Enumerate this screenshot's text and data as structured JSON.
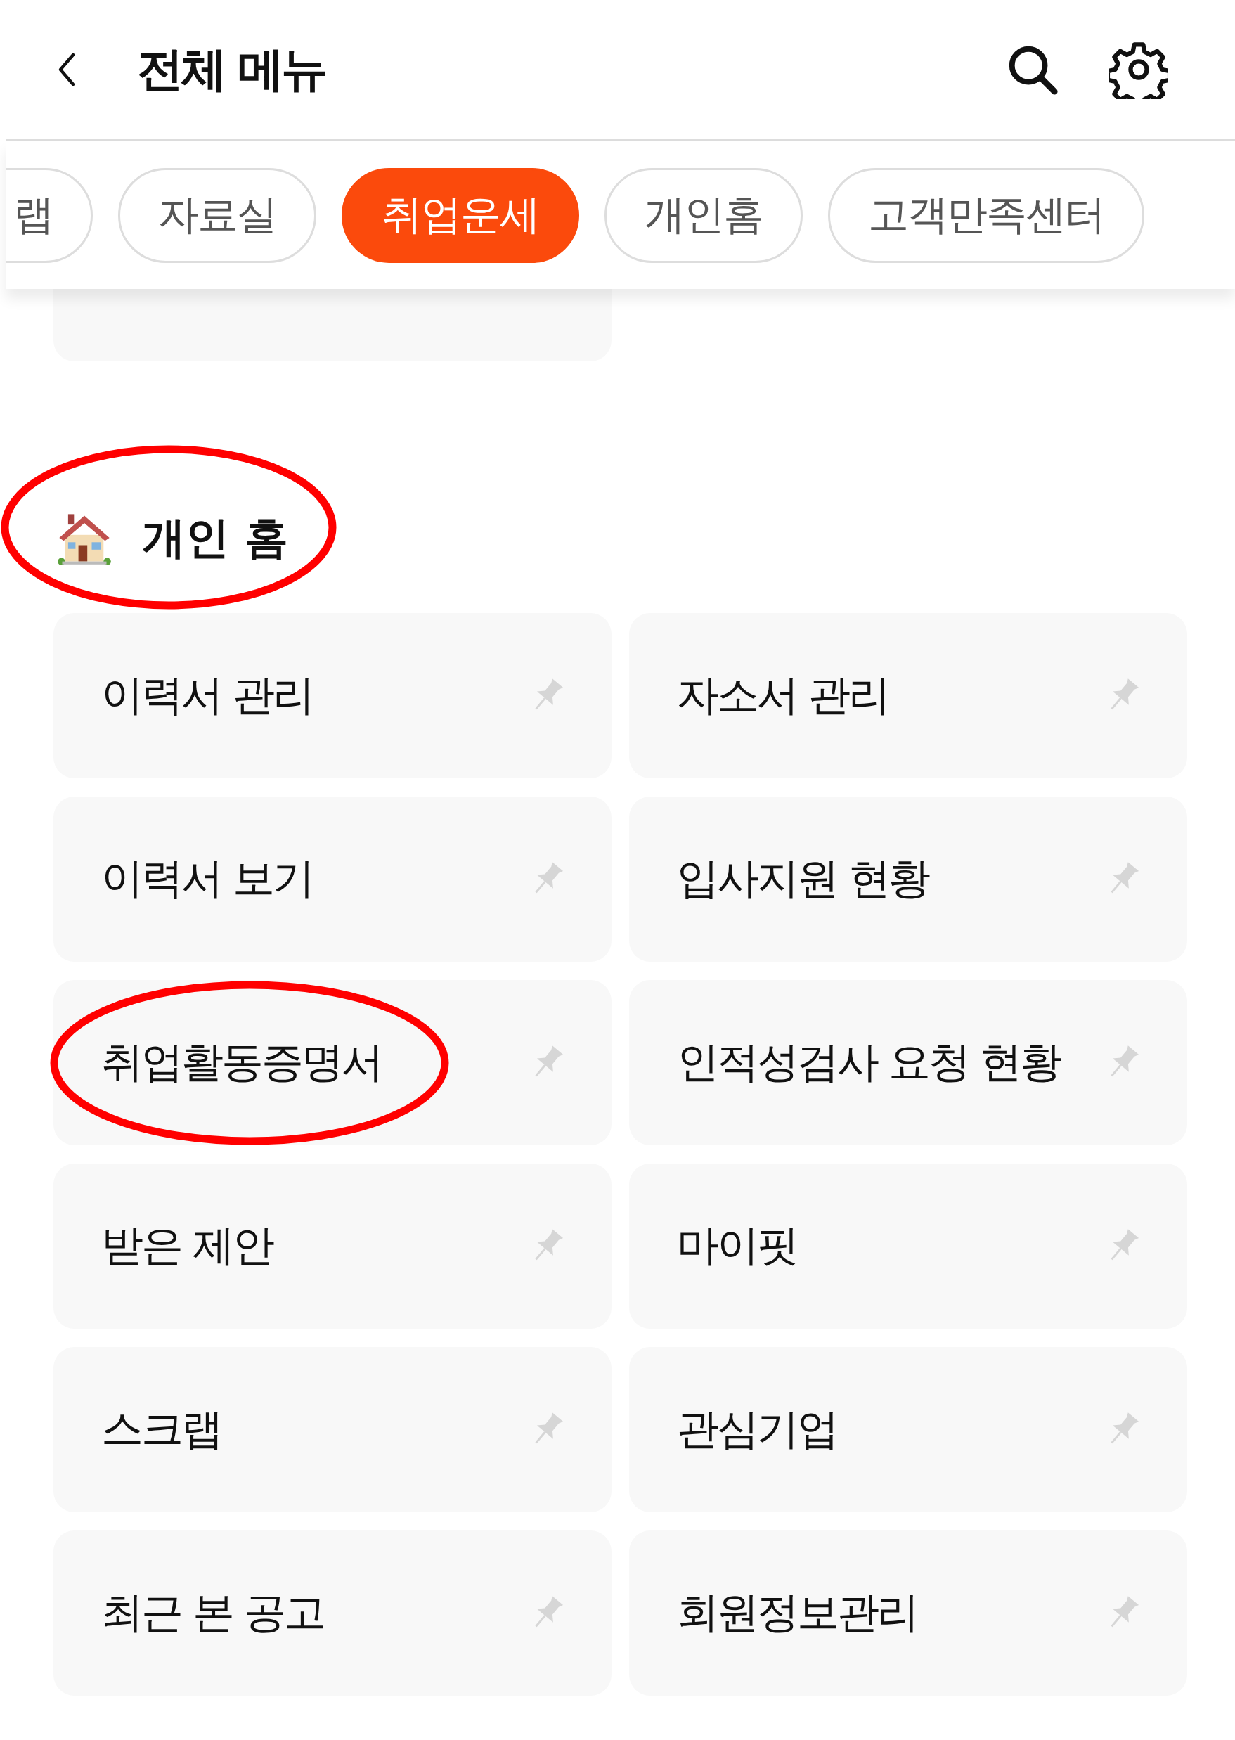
{
  "header": {
    "title": "전체 메뉴"
  },
  "tabs": [
    {
      "label": "랩",
      "selected": false
    },
    {
      "label": "자료실",
      "selected": false
    },
    {
      "label": "취업운세",
      "selected": true
    },
    {
      "label": "개인홈",
      "selected": false
    },
    {
      "label": "고객만족센터",
      "selected": false
    }
  ],
  "section": {
    "title": "개인 홈",
    "circled": true,
    "items": [
      {
        "label": "이력서 관리",
        "circled": false
      },
      {
        "label": "자소서 관리",
        "circled": false
      },
      {
        "label": "이력서 보기",
        "circled": false
      },
      {
        "label": "입사지원 현황",
        "circled": false
      },
      {
        "label": "취업활동증명서",
        "circled": true
      },
      {
        "label": "인적성검사 요청 현황",
        "circled": false
      },
      {
        "label": "받은 제안",
        "circled": false
      },
      {
        "label": "마이핏",
        "circled": false
      },
      {
        "label": "스크랩",
        "circled": false
      },
      {
        "label": "관심기업",
        "circled": false
      },
      {
        "label": "최근 본 공고",
        "circled": false
      },
      {
        "label": "회원정보관리",
        "circled": false
      }
    ]
  }
}
